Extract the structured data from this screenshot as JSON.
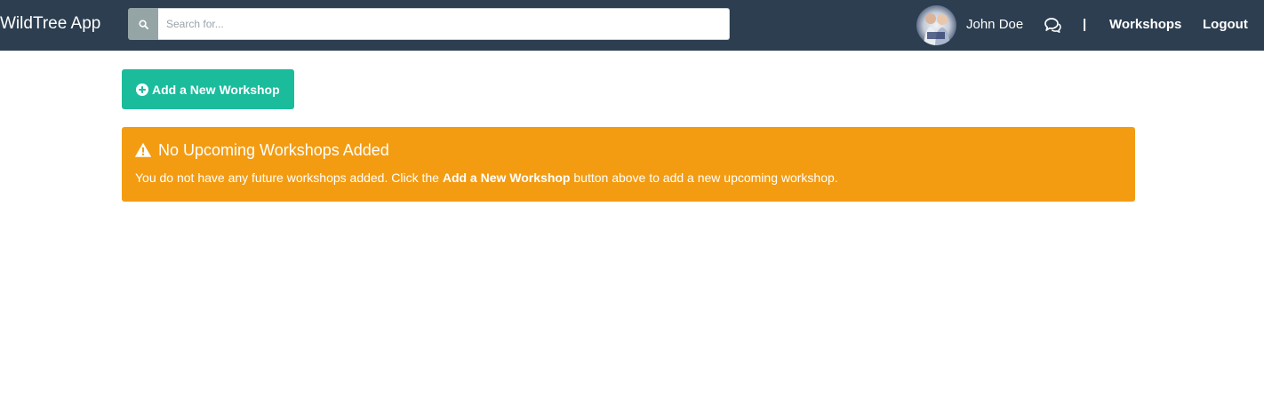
{
  "app": {
    "title": "WildTree App"
  },
  "search": {
    "placeholder": "Search for..."
  },
  "user": {
    "name": "John Doe"
  },
  "nav": {
    "separator": "|",
    "workshops_label": "Workshops",
    "logout_label": "Logout"
  },
  "toolbar": {
    "add_workshop_label": "Add a New Workshop"
  },
  "alert": {
    "title": "No Upcoming Workshops Added",
    "message_prefix": "You do not have any future workshops added. Click the ",
    "message_emphasis": "Add a New Workshop",
    "message_suffix": " button above to add a new upcoming workshop."
  },
  "icons": {
    "search": "search-icon",
    "chat": "comments-icon",
    "add": "plus-circle-icon",
    "warning": "warning-icon"
  },
  "colors": {
    "navbar": "#2c3e50",
    "search_button": "#95a5a6",
    "primary_button": "#1abc9c",
    "warning_alert": "#f39c12"
  }
}
